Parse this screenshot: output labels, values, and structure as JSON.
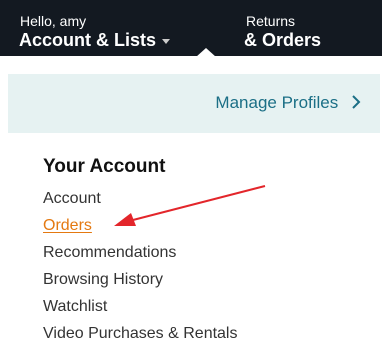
{
  "nav": {
    "account_greeting": "Hello, amy",
    "account_label": "Account & Lists",
    "returns_label_top": "Returns",
    "returns_label_bottom": "& Orders"
  },
  "profiles": {
    "manage_label": "Manage Profiles"
  },
  "account": {
    "heading": "Your Account",
    "links": [
      {
        "label": "Account",
        "active": false
      },
      {
        "label": "Orders",
        "active": true
      },
      {
        "label": "Recommendations",
        "active": false
      },
      {
        "label": "Browsing History",
        "active": false
      },
      {
        "label": "Watchlist",
        "active": false
      },
      {
        "label": "Video Purchases & Rentals",
        "active": false
      }
    ]
  },
  "colors": {
    "nav_background": "#131921",
    "profiles_band": "#e6f2f2",
    "link_teal": "#1b6f86",
    "active_orange": "#e47911",
    "annotation_red": "#e3262b"
  },
  "icons": {
    "dropdown": "caret-down-icon",
    "manage_profiles": "chevron-right-icon",
    "annotation": "red-arrow-icon"
  }
}
